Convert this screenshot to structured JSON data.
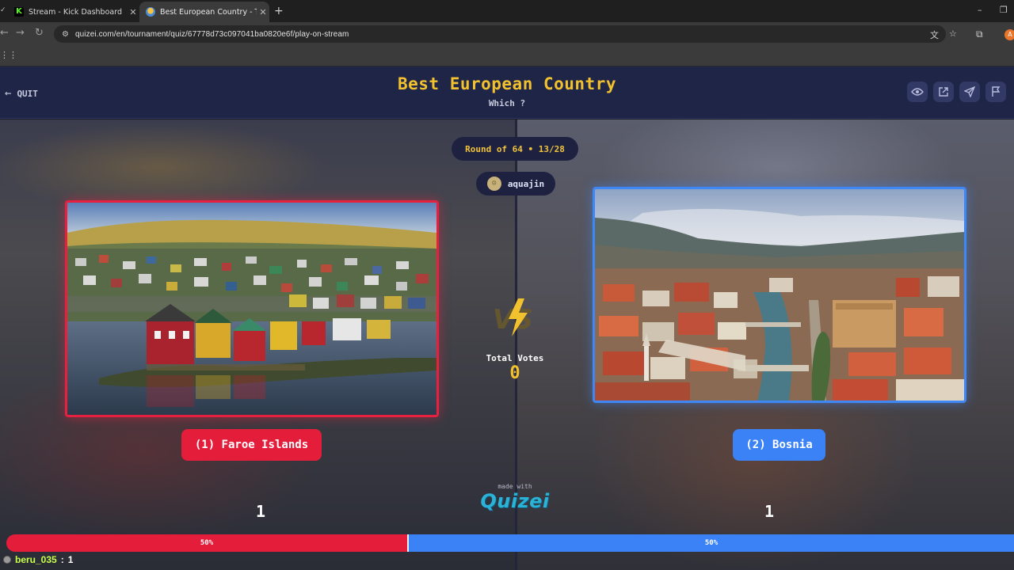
{
  "browser": {
    "tabs": [
      {
        "title": "Stream - Kick Dashboard",
        "active": false
      },
      {
        "title": "Best European Country - Tier Li",
        "active": true
      }
    ],
    "url": "quizei.com/en/tournament/quiz/67778d73c097041ba0820e6f/play-on-stream",
    "profile_initial": "A"
  },
  "header": {
    "quit_label": "QUIT",
    "title": "Best European Country",
    "subtitle": "Which ?"
  },
  "round": {
    "label": "Round of 64 • 13/28"
  },
  "streamer": {
    "name": "aquajin"
  },
  "matchup": {
    "left": {
      "label": "(1) Faroe Islands",
      "votes": "1",
      "color": "#e31d3a"
    },
    "right": {
      "label": "(2) Bosnia",
      "votes": "1",
      "color": "#3b82f6"
    }
  },
  "total_votes": {
    "label": "Total Votes",
    "value": "0"
  },
  "branding": {
    "made_with": "made with",
    "logo": "QUIZEI"
  },
  "progress": {
    "left_label": "50%",
    "right_label": "50%",
    "left_fraction": 0.5
  },
  "voter": {
    "name": "beru_035",
    "separator": ":",
    "count": "1"
  },
  "colors": {
    "accent_yellow": "#f2c12e",
    "header_bg": "#1f2547",
    "red": "#e31d3a",
    "blue": "#3b82f6"
  }
}
